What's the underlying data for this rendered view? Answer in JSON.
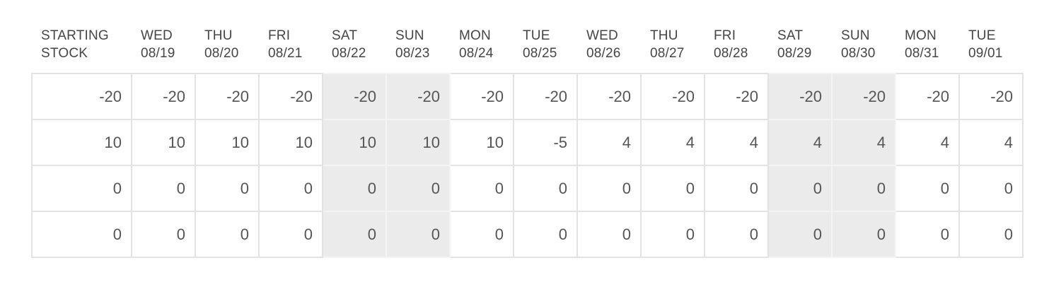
{
  "header": {
    "columns": [
      {
        "line1": "STARTING",
        "line2": "STOCK",
        "weekend": false
      },
      {
        "line1": "WED",
        "line2": "08/19",
        "weekend": false
      },
      {
        "line1": "THU",
        "line2": "08/20",
        "weekend": false
      },
      {
        "line1": "FRI",
        "line2": "08/21",
        "weekend": false
      },
      {
        "line1": "SAT",
        "line2": "08/22",
        "weekend": true
      },
      {
        "line1": "SUN",
        "line2": "08/23",
        "weekend": true
      },
      {
        "line1": "MON",
        "line2": "08/24",
        "weekend": false
      },
      {
        "line1": "TUE",
        "line2": "08/25",
        "weekend": false
      },
      {
        "line1": "WED",
        "line2": "08/26",
        "weekend": false
      },
      {
        "line1": "THU",
        "line2": "08/27",
        "weekend": false
      },
      {
        "line1": "FRI",
        "line2": "08/28",
        "weekend": false
      },
      {
        "line1": "SAT",
        "line2": "08/29",
        "weekend": true
      },
      {
        "line1": "SUN",
        "line2": "08/30",
        "weekend": true
      },
      {
        "line1": "MON",
        "line2": "08/31",
        "weekend": false
      },
      {
        "line1": "TUE",
        "line2": "09/01",
        "weekend": false
      }
    ]
  },
  "rows": [
    [
      "-20",
      "-20",
      "-20",
      "-20",
      "-20",
      "-20",
      "-20",
      "-20",
      "-20",
      "-20",
      "-20",
      "-20",
      "-20",
      "-20",
      "-20"
    ],
    [
      "10",
      "10",
      "10",
      "10",
      "10",
      "10",
      "10",
      "-5",
      "4",
      "4",
      "4",
      "4",
      "4",
      "4",
      "4"
    ],
    [
      "0",
      "0",
      "0",
      "0",
      "0",
      "0",
      "0",
      "0",
      "0",
      "0",
      "0",
      "0",
      "0",
      "0",
      "0"
    ],
    [
      "0",
      "0",
      "0",
      "0",
      "0",
      "0",
      "0",
      "0",
      "0",
      "0",
      "0",
      "0",
      "0",
      "0",
      "0"
    ]
  ],
  "colors": {
    "weekend_background": "#ebebeb",
    "grid_line": "#e3e3e3",
    "text": "#555555"
  }
}
